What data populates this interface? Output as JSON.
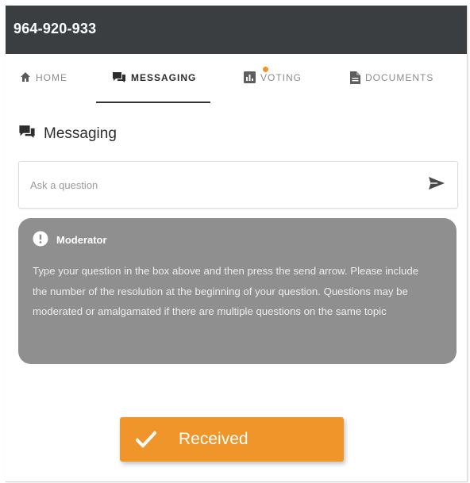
{
  "header": {
    "title": "964-920-933"
  },
  "tabs": [
    {
      "label": "HOME",
      "icon": "home-icon"
    },
    {
      "label": "MESSAGING",
      "icon": "chat-icon",
      "active": true
    },
    {
      "label": "VOTING",
      "icon": "bar-chart-icon",
      "has_notification": true
    },
    {
      "label": "DOCUMENTS",
      "icon": "document-icon"
    }
  ],
  "messaging": {
    "heading": "Messaging",
    "input_placeholder": "Ask a question",
    "send_icon": "send-icon"
  },
  "moderator": {
    "icon": "info-icon",
    "title": "Moderator",
    "message": "Type your question in the box above and then press the send arrow. Please include the number of the resolution at the beginning of your question. Questions may be moderated or amalgamated if there are multiple questions on the same topic"
  },
  "toast": {
    "icon": "checkmark-icon",
    "message": "Received"
  },
  "colors": {
    "topbar": "#3b3e41",
    "accent": "#f0952a",
    "moderator_card": "#8f8f8f",
    "active_tab": "#2c2c2c",
    "inactive_tab": "#8c8c8c"
  }
}
